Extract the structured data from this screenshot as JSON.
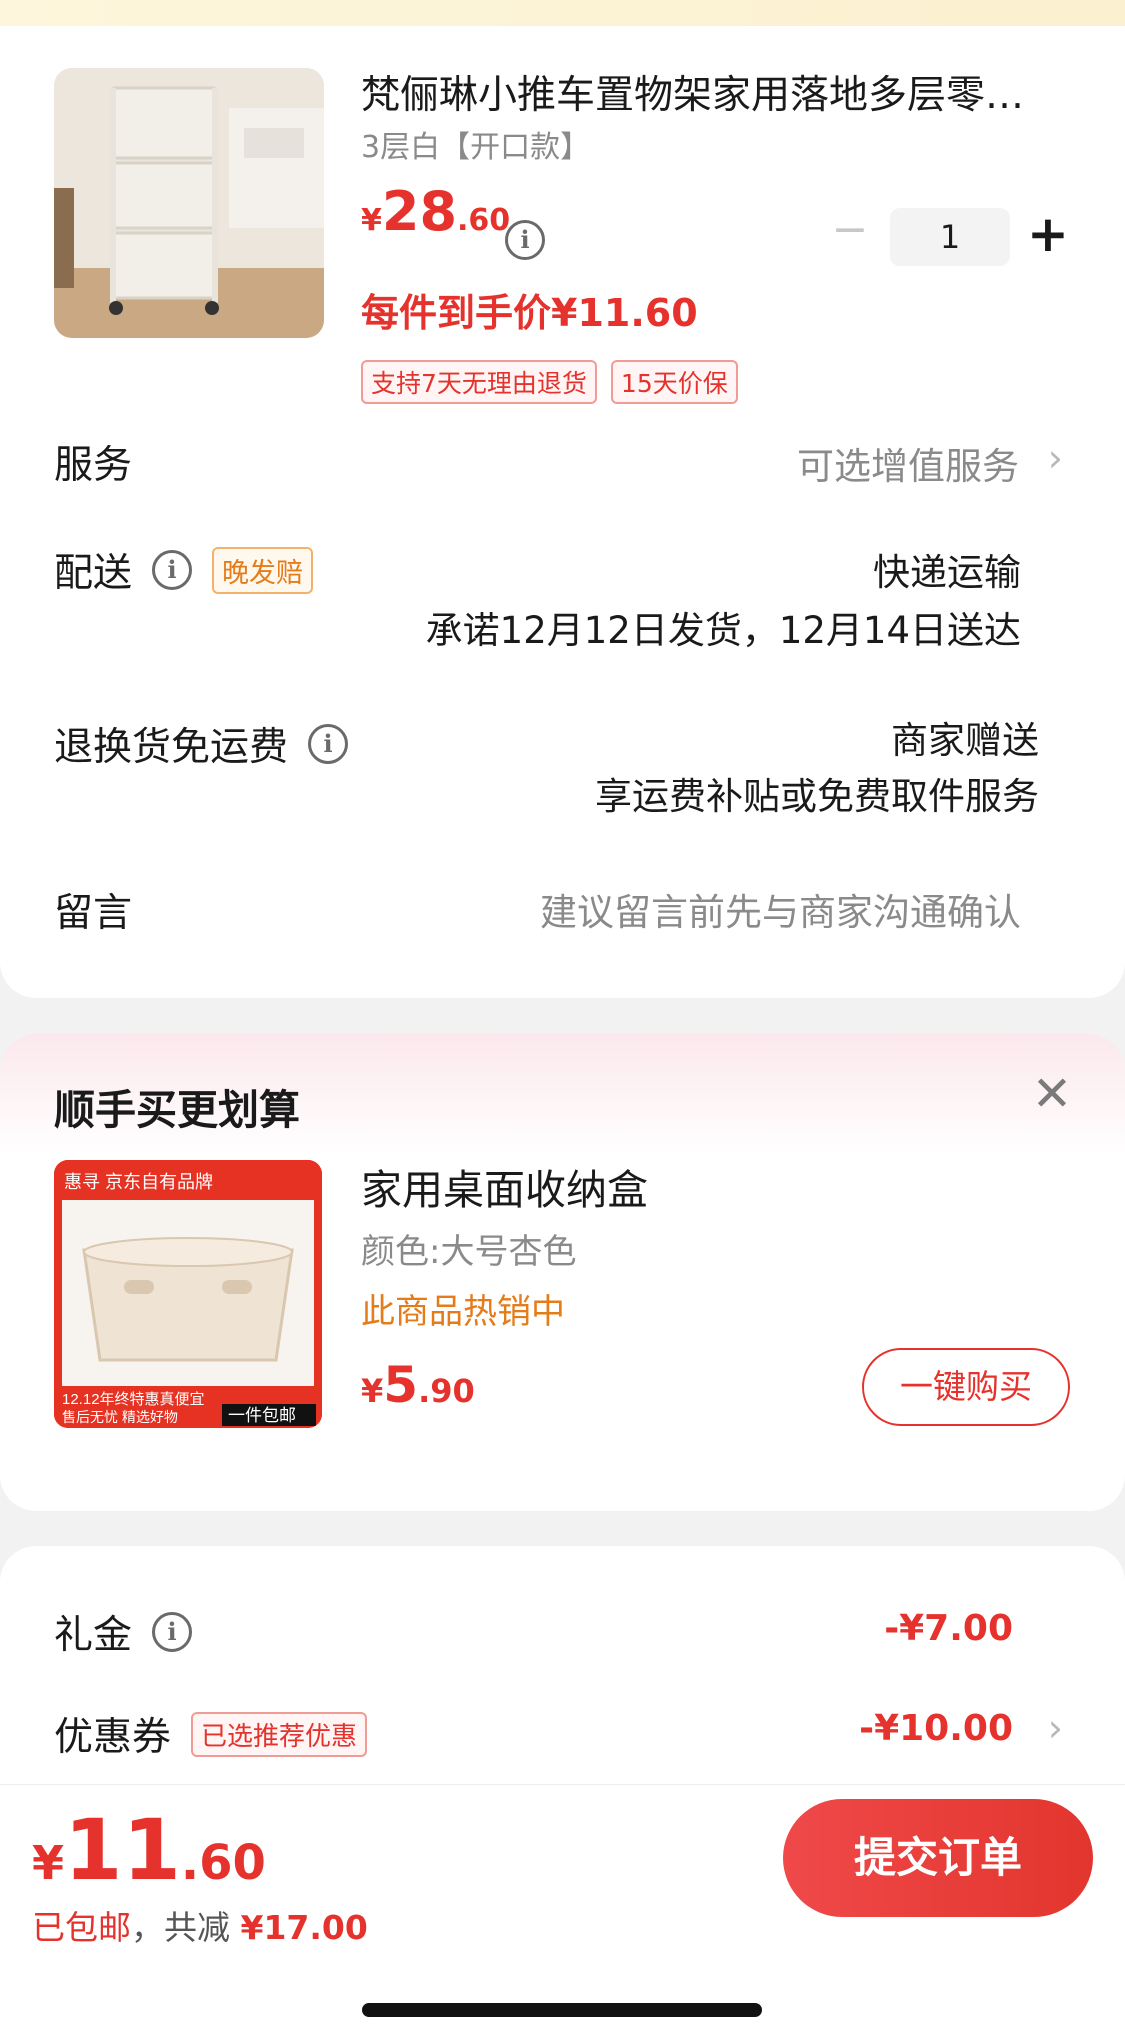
{
  "product": {
    "title": "梵俪琳小推车置物架家用落地多层零…",
    "spec": "3层白【开口款】",
    "price_symbol": "¥",
    "price_int": "28",
    "price_dec": ".60",
    "quantity": "1",
    "per_item_price": "每件到手价¥11.60",
    "tags": [
      "支持7天无理由退货",
      "15天价保"
    ]
  },
  "rows": {
    "service_label": "服务",
    "service_value": "可选增值服务",
    "delivery_label": "配送",
    "delivery_badge": "晚发赔",
    "delivery_method": "快递运输",
    "delivery_promise": "承诺12月12日发货，12月14日送达",
    "return_label": "退换货免运费",
    "return_value_1": "商家赠送",
    "return_value_2": "享运费补贴或免费取件服务",
    "message_label": "留言",
    "message_placeholder": "建议留言前先与商家沟通确认"
  },
  "upsell": {
    "title": "顺手买更划算",
    "name": "家用桌面收纳盒",
    "color": "颜色:大号杏色",
    "hot": "此商品热销中",
    "price_symbol": "¥",
    "price_int": "5",
    "price_dec": ".90",
    "buy_label": "一键购买",
    "img_brand": "惠寻 京东自有品牌",
    "img_promo": "12.12年终特惠真便宜",
    "img_sub": "售后无忧 精选好物",
    "img_ship": "一件包邮"
  },
  "discounts": {
    "gift_label": "礼金",
    "gift_value": "-¥7.00",
    "coupon_label": "优惠券",
    "coupon_badge": "已选推荐优惠",
    "coupon_value": "-¥10.00"
  },
  "footer": {
    "total_symbol": "¥",
    "total_int": "11",
    "total_dec": ".60",
    "shipping": "已包邮",
    "sep": "，",
    "saved_label": "共减",
    "saved_value": "¥17.00",
    "submit_label": "提交订单"
  },
  "colors": {
    "accent": "#e5322d",
    "orange": "#e57c1a"
  }
}
